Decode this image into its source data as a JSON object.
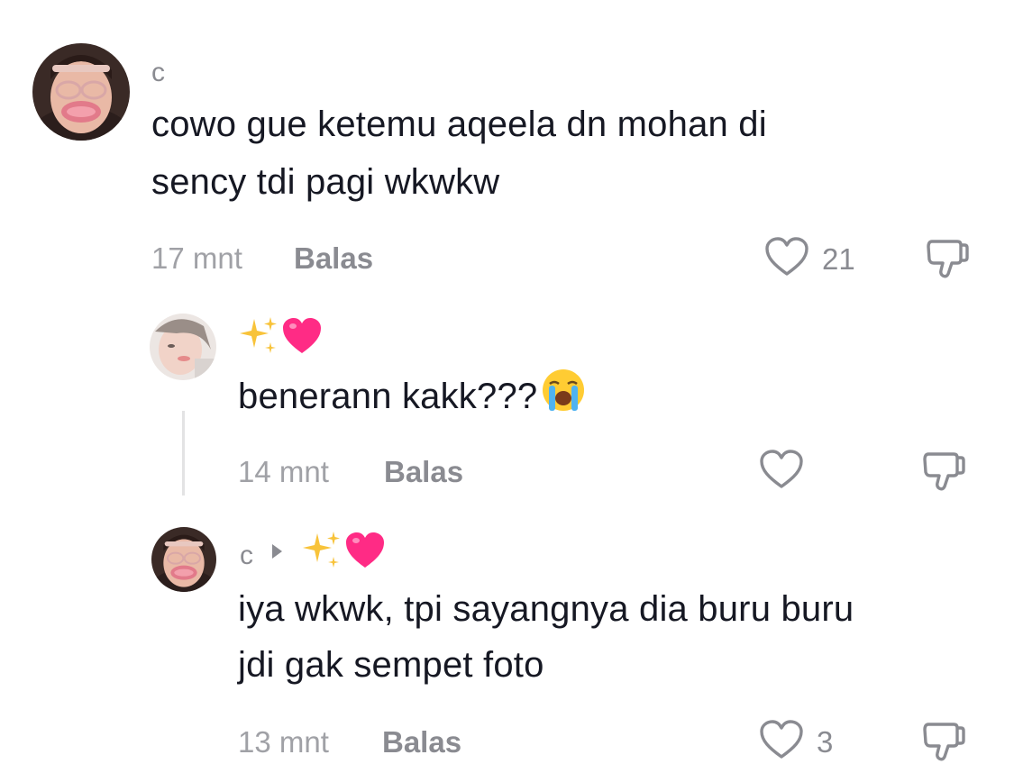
{
  "comments": [
    {
      "username": "c",
      "text_line1": "cowo gue ketemu aqeela dn mohan di",
      "text_line2": "sency tdi pagi wkwkw",
      "time": "17 mnt",
      "reply_label": "Balas",
      "likes": "21"
    },
    {
      "username_emojis": [
        "sparkles",
        "pink-heart"
      ],
      "text": "benerann kakk???",
      "text_emoji": "loudly-crying-face",
      "time": "14 mnt",
      "reply_label": "Balas",
      "likes": ""
    },
    {
      "username": "c",
      "reply_to_emojis": [
        "sparkles",
        "pink-heart"
      ],
      "text_line1": "iya wkwk, tpi sayangnya dia buru buru",
      "text_line2": "jdi gak sempet foto",
      "time": "13 mnt",
      "reply_label": "Balas",
      "likes": "3"
    }
  ],
  "icons": {
    "like": "heart-outline-icon",
    "dislike": "thumbs-down-outline-icon"
  },
  "colors": {
    "text": "#161823",
    "muted": "#8a8b91",
    "heart": "#ff2b85",
    "sparkle": "#f8c33a"
  }
}
